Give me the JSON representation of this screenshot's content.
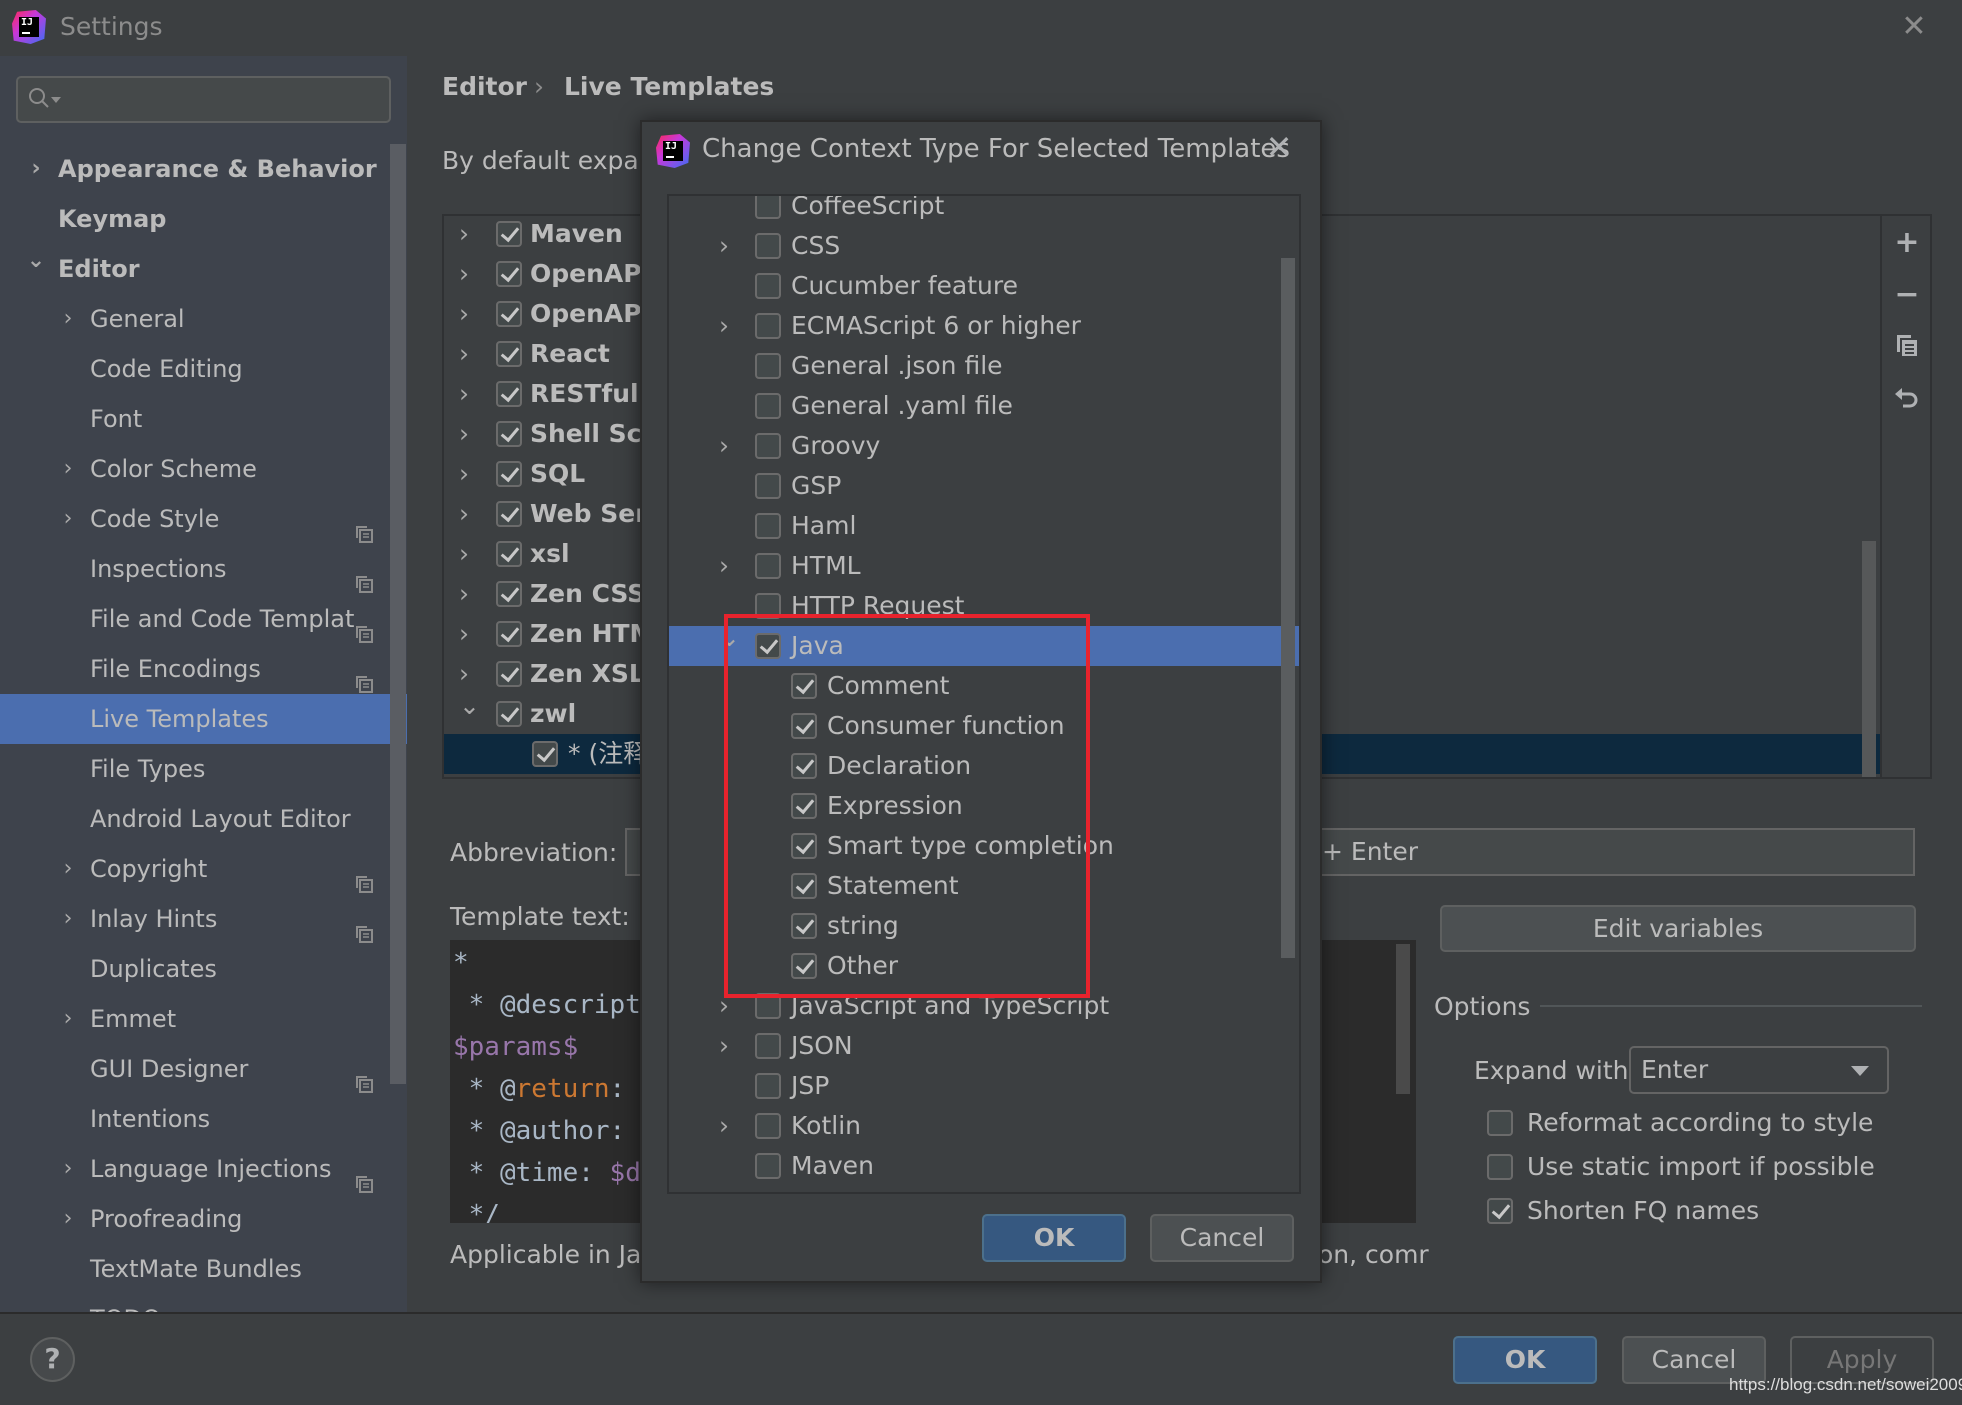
{
  "window": {
    "title": "Settings",
    "close_icon": "close-icon",
    "logo_text": "IJ"
  },
  "sidebar": {
    "search": {
      "value": "",
      "placeholder": ""
    },
    "items": [
      {
        "label": "Appearance & Behavior",
        "level": 0,
        "expander": "collapsed",
        "bold": true,
        "project": false
      },
      {
        "label": "Keymap",
        "level": 0,
        "expander": "none",
        "bold": true,
        "project": false
      },
      {
        "label": "Editor",
        "level": 0,
        "expander": "expanded",
        "bold": true,
        "project": false
      },
      {
        "label": "General",
        "level": 1,
        "expander": "collapsed",
        "project": false
      },
      {
        "label": "Code Editing",
        "level": 1,
        "expander": "none",
        "project": false
      },
      {
        "label": "Font",
        "level": 1,
        "expander": "none",
        "project": false
      },
      {
        "label": "Color Scheme",
        "level": 1,
        "expander": "collapsed",
        "project": false
      },
      {
        "label": "Code Style",
        "level": 1,
        "expander": "collapsed",
        "project": true
      },
      {
        "label": "Inspections",
        "level": 1,
        "expander": "none",
        "project": true
      },
      {
        "label": "File and Code Templat",
        "level": 1,
        "expander": "none",
        "project": true
      },
      {
        "label": "File Encodings",
        "level": 1,
        "expander": "none",
        "project": true
      },
      {
        "label": "Live Templates",
        "level": 1,
        "expander": "none",
        "project": false,
        "selected": true
      },
      {
        "label": "File Types",
        "level": 1,
        "expander": "none",
        "project": false
      },
      {
        "label": "Android Layout Editor",
        "level": 1,
        "expander": "none",
        "project": false
      },
      {
        "label": "Copyright",
        "level": 1,
        "expander": "collapsed",
        "project": true
      },
      {
        "label": "Inlay Hints",
        "level": 1,
        "expander": "collapsed",
        "project": true
      },
      {
        "label": "Duplicates",
        "level": 1,
        "expander": "none",
        "project": false
      },
      {
        "label": "Emmet",
        "level": 1,
        "expander": "collapsed",
        "project": false
      },
      {
        "label": "GUI Designer",
        "level": 1,
        "expander": "none",
        "project": true
      },
      {
        "label": "Intentions",
        "level": 1,
        "expander": "none",
        "project": false
      },
      {
        "label": "Language Injections",
        "level": 1,
        "expander": "collapsed",
        "project": true
      },
      {
        "label": "Proofreading",
        "level": 1,
        "expander": "collapsed",
        "project": false
      },
      {
        "label": "TextMate Bundles",
        "level": 1,
        "expander": "none",
        "project": false
      },
      {
        "label": "TODO",
        "level": 1,
        "expander": "none",
        "project": false
      }
    ]
  },
  "breadcrumb": {
    "parent": "Editor",
    "separator": "›",
    "current": "Live Templates"
  },
  "main": {
    "expand_hint": "By default expand",
    "template_groups": [
      {
        "label": "Maven",
        "checked": true,
        "expanded": false
      },
      {
        "label": "OpenAPI",
        "checked": true,
        "expanded": false
      },
      {
        "label": "OpenAPI",
        "checked": true,
        "expanded": false
      },
      {
        "label": "React",
        "checked": true,
        "expanded": false
      },
      {
        "label": "RESTful V",
        "checked": true,
        "expanded": false
      },
      {
        "label": "Shell Scri",
        "checked": true,
        "expanded": false
      },
      {
        "label": "SQL",
        "checked": true,
        "expanded": false
      },
      {
        "label": "Web Serv",
        "checked": true,
        "expanded": false
      },
      {
        "label": "xsl",
        "checked": true,
        "expanded": false
      },
      {
        "label": "Zen CSS",
        "checked": true,
        "expanded": false
      },
      {
        "label": "Zen HTM",
        "checked": true,
        "expanded": false
      },
      {
        "label": "Zen XSL",
        "checked": true,
        "expanded": false
      },
      {
        "label": "zwl",
        "checked": true,
        "expanded": true
      }
    ],
    "selected_template": {
      "label": "* (注释",
      "checked": true
    },
    "toolbar": [
      "add-icon",
      "remove-icon",
      "copy-icon",
      "revert-icon"
    ],
    "abbreviation_label": "Abbreviation:",
    "abbreviation_value": "",
    "expand_shortcut_fragment": "+ Enter",
    "template_text_label": "Template text:",
    "template_lines": [
      [
        {
          "t": "*",
          "c": ""
        }
      ],
      [
        {
          "t": " * @descript",
          "c": ""
        }
      ],
      [
        {
          "t": "$params$",
          "c": "purple"
        }
      ],
      [
        {
          "t": " * @",
          "c": ""
        },
        {
          "t": "return",
          "c": "orange"
        },
        {
          "t": ":",
          "c": ""
        }
      ],
      [
        {
          "t": " * @author:",
          "c": ""
        }
      ],
      [
        {
          "t": " * @time: ",
          "c": ""
        },
        {
          "t": "$d",
          "c": "purple"
        }
      ],
      [
        {
          "t": " */",
          "c": ""
        }
      ]
    ],
    "applicable_text": "Applicable in Jav",
    "applicable_tail": "on, comr",
    "edit_variables_label": "Edit variables",
    "options": {
      "title": "Options",
      "expand_with_label": "Expand with",
      "expand_with_value": "Enter",
      "checkboxes": [
        {
          "label": "Reformat according to style",
          "checked": false
        },
        {
          "label": "Use static import if possible",
          "checked": false
        },
        {
          "label": "Shorten FQ names",
          "checked": true
        }
      ]
    }
  },
  "dialog": {
    "title": "Change Context Type For Selected Templates",
    "items": [
      {
        "label": "CoffeeScript",
        "level": 0,
        "expander": "none",
        "checked": false
      },
      {
        "label": "CSS",
        "level": 0,
        "expander": "collapsed",
        "checked": false
      },
      {
        "label": "Cucumber feature",
        "level": 0,
        "expander": "none",
        "checked": false
      },
      {
        "label": "ECMAScript 6 or higher",
        "level": 0,
        "expander": "collapsed",
        "checked": false
      },
      {
        "label": "General .json file",
        "level": 0,
        "expander": "none",
        "checked": false
      },
      {
        "label": "General .yaml file",
        "level": 0,
        "expander": "none",
        "checked": false
      },
      {
        "label": "Groovy",
        "level": 0,
        "expander": "collapsed",
        "checked": false
      },
      {
        "label": "GSP",
        "level": 0,
        "expander": "none",
        "checked": false
      },
      {
        "label": "Haml",
        "level": 0,
        "expander": "none",
        "checked": false
      },
      {
        "label": "HTML",
        "level": 0,
        "expander": "collapsed",
        "checked": false
      },
      {
        "label": "HTTP Request",
        "level": 0,
        "expander": "none",
        "checked": false
      },
      {
        "label": "Java",
        "level": 0,
        "expander": "expanded",
        "checked": true,
        "selected": true
      },
      {
        "label": "Comment",
        "level": 1,
        "expander": "none",
        "checked": true
      },
      {
        "label": "Consumer function",
        "level": 1,
        "expander": "none",
        "checked": true
      },
      {
        "label": "Declaration",
        "level": 1,
        "expander": "none",
        "checked": true
      },
      {
        "label": "Expression",
        "level": 1,
        "expander": "none",
        "checked": true
      },
      {
        "label": "Smart type completion",
        "level": 1,
        "expander": "none",
        "checked": true
      },
      {
        "label": "Statement",
        "level": 1,
        "expander": "none",
        "checked": true
      },
      {
        "label": "string",
        "level": 1,
        "expander": "none",
        "checked": true
      },
      {
        "label": "Other",
        "level": 1,
        "expander": "none",
        "checked": true
      },
      {
        "label": "JavaScript and TypeScript",
        "level": 0,
        "expander": "collapsed",
        "checked": false
      },
      {
        "label": "JSON",
        "level": 0,
        "expander": "collapsed",
        "checked": false
      },
      {
        "label": "JSP",
        "level": 0,
        "expander": "none",
        "checked": false
      },
      {
        "label": "Kotlin",
        "level": 0,
        "expander": "collapsed",
        "checked": false
      },
      {
        "label": "Maven",
        "level": 0,
        "expander": "none",
        "checked": false
      }
    ],
    "ok_label": "OK",
    "cancel_label": "Cancel",
    "annotation_color": "#e8232d"
  },
  "footer": {
    "help_label": "?",
    "ok_label": "OK",
    "cancel_label": "Cancel",
    "apply_label": "Apply",
    "watermark": "https://blog.csdn.net/sowei2009"
  },
  "colors": {
    "selection": "#4b6eaf",
    "primary_button": "#365880",
    "background": "#3c3f41",
    "sidebar": "#3e434c"
  }
}
